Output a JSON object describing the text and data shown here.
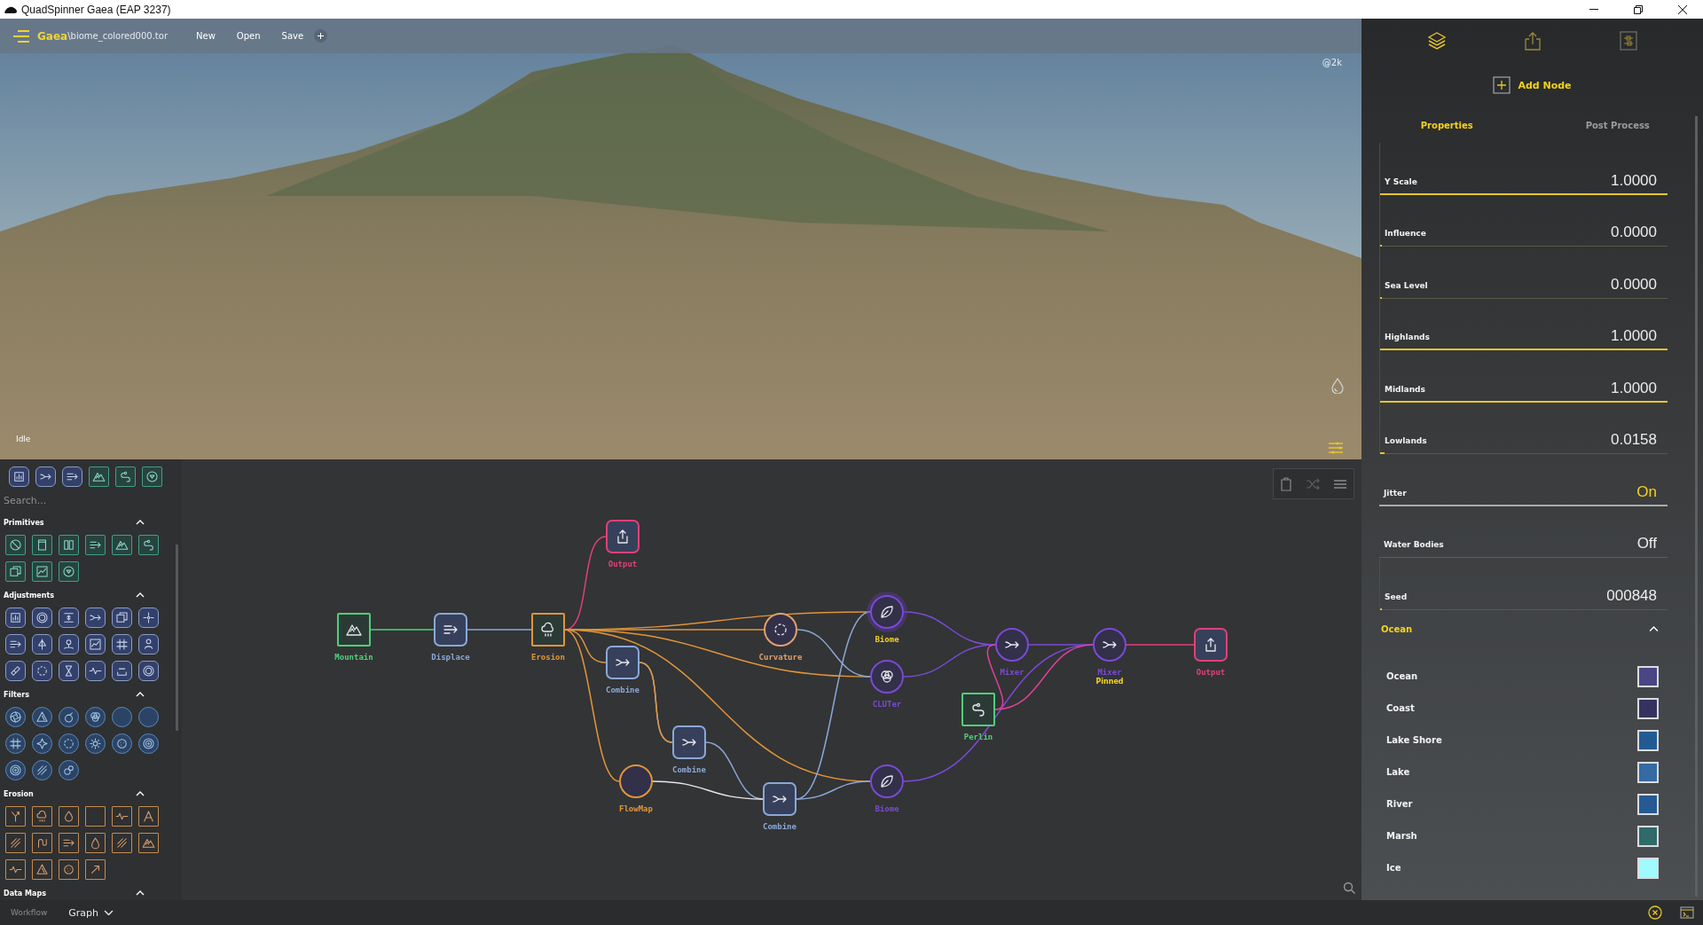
{
  "window": {
    "title": "QuadSpinner Gaea (EAP 3237)"
  },
  "toolbar": {
    "app": "Gaea",
    "file": "\\biome_colored000.tor",
    "menu": [
      "New",
      "Open",
      "Save"
    ]
  },
  "viewport": {
    "resolution": "@2k",
    "status": "Idle"
  },
  "palette": {
    "search": {
      "placeholder": "Search..."
    },
    "sections": [
      {
        "title": "Primitives",
        "kind": "primitives",
        "expanded": true
      },
      {
        "title": "Adjustments",
        "kind": "adjustments",
        "expanded": true
      },
      {
        "title": "Filters",
        "kind": "filters",
        "expanded": true
      },
      {
        "title": "Erosion",
        "kind": "erosion",
        "expanded": true
      },
      {
        "title": "Data Maps",
        "kind": "datamaps",
        "expanded": true
      }
    ]
  },
  "graph": {
    "nodes": [
      {
        "label": "Mountain",
        "kind": "square",
        "color": "#4ed07a",
        "selected": false
      },
      {
        "label": "Displace",
        "kind": "rounded",
        "color": "#8aa8d8",
        "selected": false
      },
      {
        "label": "Erosion",
        "kind": "square",
        "color": "#e0953a",
        "selected": false
      },
      {
        "label": "Output",
        "kind": "rounded",
        "color": "#e0407a",
        "selected": false
      },
      {
        "label": "Curvature",
        "kind": "circle",
        "color": "#e0a070",
        "selected": false
      },
      {
        "label": "Combine",
        "kind": "rounded",
        "color": "#8aa8d8",
        "selected": false
      },
      {
        "label": "Biome",
        "kind": "circle",
        "color": "#7a4ad8",
        "selected": true
      },
      {
        "label": "CLUTer",
        "kind": "circle",
        "color": "#7a4ad8",
        "selected": false
      },
      {
        "label": "Combine",
        "kind": "rounded",
        "color": "#8aa8d8",
        "selected": false
      },
      {
        "label": "FlowMap",
        "kind": "circle",
        "color": "#e0953a",
        "selected": false
      },
      {
        "label": "Combine",
        "kind": "rounded",
        "color": "#8aa8d8",
        "selected": false
      },
      {
        "label": "Biome",
        "kind": "circle",
        "color": "#7a4ad8",
        "selected": false
      },
      {
        "label": "Perlin",
        "kind": "square",
        "color": "#4ed07a",
        "selected": false
      },
      {
        "label": "Mixer",
        "kind": "circle",
        "color": "#7a4ad8",
        "selected": false
      },
      {
        "label": "Mixer",
        "kind": "circle",
        "color": "#7a4ad8",
        "selected": false,
        "note": "Pinned"
      },
      {
        "label": "Output",
        "kind": "rounded",
        "color": "#e0407a",
        "selected": false
      }
    ]
  },
  "panel": {
    "add_node": "Add Node",
    "tabs": [
      {
        "label": "Properties",
        "selected": true
      },
      {
        "label": "Post Process",
        "selected": false
      }
    ],
    "properties": [
      {
        "kind": "slider",
        "label": "Y Scale",
        "value": "1.0000",
        "level": 1
      },
      {
        "kind": "slider",
        "label": "Influence",
        "value": "0.0000",
        "level": 0
      },
      {
        "kind": "slider",
        "label": "Sea Level",
        "value": "0.0000",
        "level": 0
      },
      {
        "kind": "slider",
        "label": "Highlands",
        "value": "1.0000",
        "level": 1
      },
      {
        "kind": "slider",
        "label": "Midlands",
        "value": "1.0000",
        "level": 1
      },
      {
        "kind": "slider",
        "label": "Lowlands",
        "value": "0.0158",
        "level": 0.0158
      },
      {
        "kind": "toggle",
        "label": "Jitter",
        "value": "On",
        "on": true
      },
      {
        "kind": "toggle",
        "label": "Water Bodies",
        "value": "Off",
        "on": false
      },
      {
        "kind": "slider",
        "label": "Seed",
        "value": "000848",
        "level": 0.005
      }
    ],
    "group": {
      "title": "Ocean",
      "expanded": true,
      "swatches": [
        {
          "label": "Ocean",
          "color": "#4a4585"
        },
        {
          "label": "Coast",
          "color": "#363260"
        },
        {
          "label": "Lake Shore",
          "color": "#245a92"
        },
        {
          "label": "Lake",
          "color": "#356aa3"
        },
        {
          "label": "River",
          "color": "#265a92"
        },
        {
          "label": "Marsh",
          "color": "#2f6b68"
        },
        {
          "label": "Ice",
          "color": "#a0fbff"
        }
      ]
    }
  },
  "status_bar": {
    "tabs": [
      {
        "label": "Workflow",
        "selected": false
      },
      {
        "label": "Graph",
        "selected": true
      }
    ]
  }
}
